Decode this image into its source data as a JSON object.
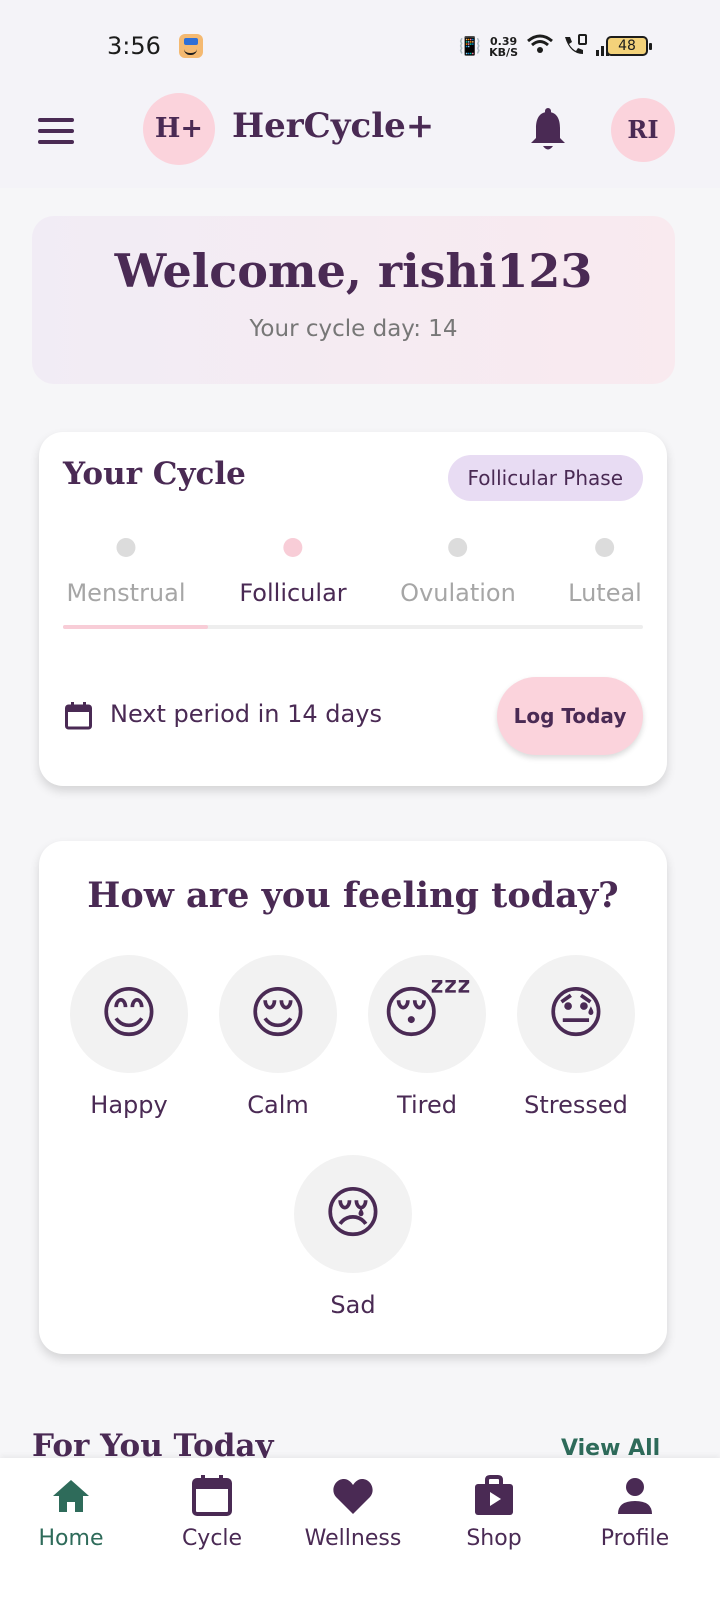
{
  "status_bar": {
    "time": "3:56",
    "speed_top": "0.39",
    "speed_unit": "KB/S",
    "battery": "48"
  },
  "app_bar": {
    "logo_text": "H+",
    "title": "HerCycle+",
    "avatar_initials": "RI"
  },
  "welcome": {
    "title": "Welcome, rishi123",
    "subtitle": "Your cycle day: 14"
  },
  "cycle": {
    "title": "Your Cycle",
    "phase_badge": "Follicular Phase",
    "phases": [
      {
        "label": "Menstrual",
        "active": false
      },
      {
        "label": "Follicular",
        "active": true
      },
      {
        "label": "Ovulation",
        "active": false
      },
      {
        "label": "Luteal",
        "active": false
      }
    ],
    "progress_fraction": 0.25,
    "next_period": "Next period in 14 days",
    "log_button": "Log Today"
  },
  "mood": {
    "title": "How are you feeling today?",
    "options": [
      {
        "label": "Happy",
        "emoji": "😊"
      },
      {
        "label": "Calm",
        "emoji": "😌"
      },
      {
        "label": "Tired",
        "emoji": "😴"
      },
      {
        "label": "Stressed",
        "emoji": "😓"
      },
      {
        "label": "Sad",
        "emoji": "😢"
      }
    ]
  },
  "for_you": {
    "title": "For You Today",
    "view_all": "View All"
  },
  "bottom_nav": {
    "items": [
      {
        "label": "Home",
        "icon": "home-icon"
      },
      {
        "label": "Cycle",
        "icon": "calendar-icon"
      },
      {
        "label": "Wellness",
        "icon": "heart-icon"
      },
      {
        "label": "Shop",
        "icon": "shop-bag-icon"
      },
      {
        "label": "Profile",
        "icon": "person-icon"
      }
    ],
    "active_index": 0
  },
  "colors": {
    "primary": "#4a2a54",
    "accent_pink": "#fbd3dc",
    "badge_lavender": "#e8dcf3",
    "nav_active": "#2e6b5a"
  }
}
